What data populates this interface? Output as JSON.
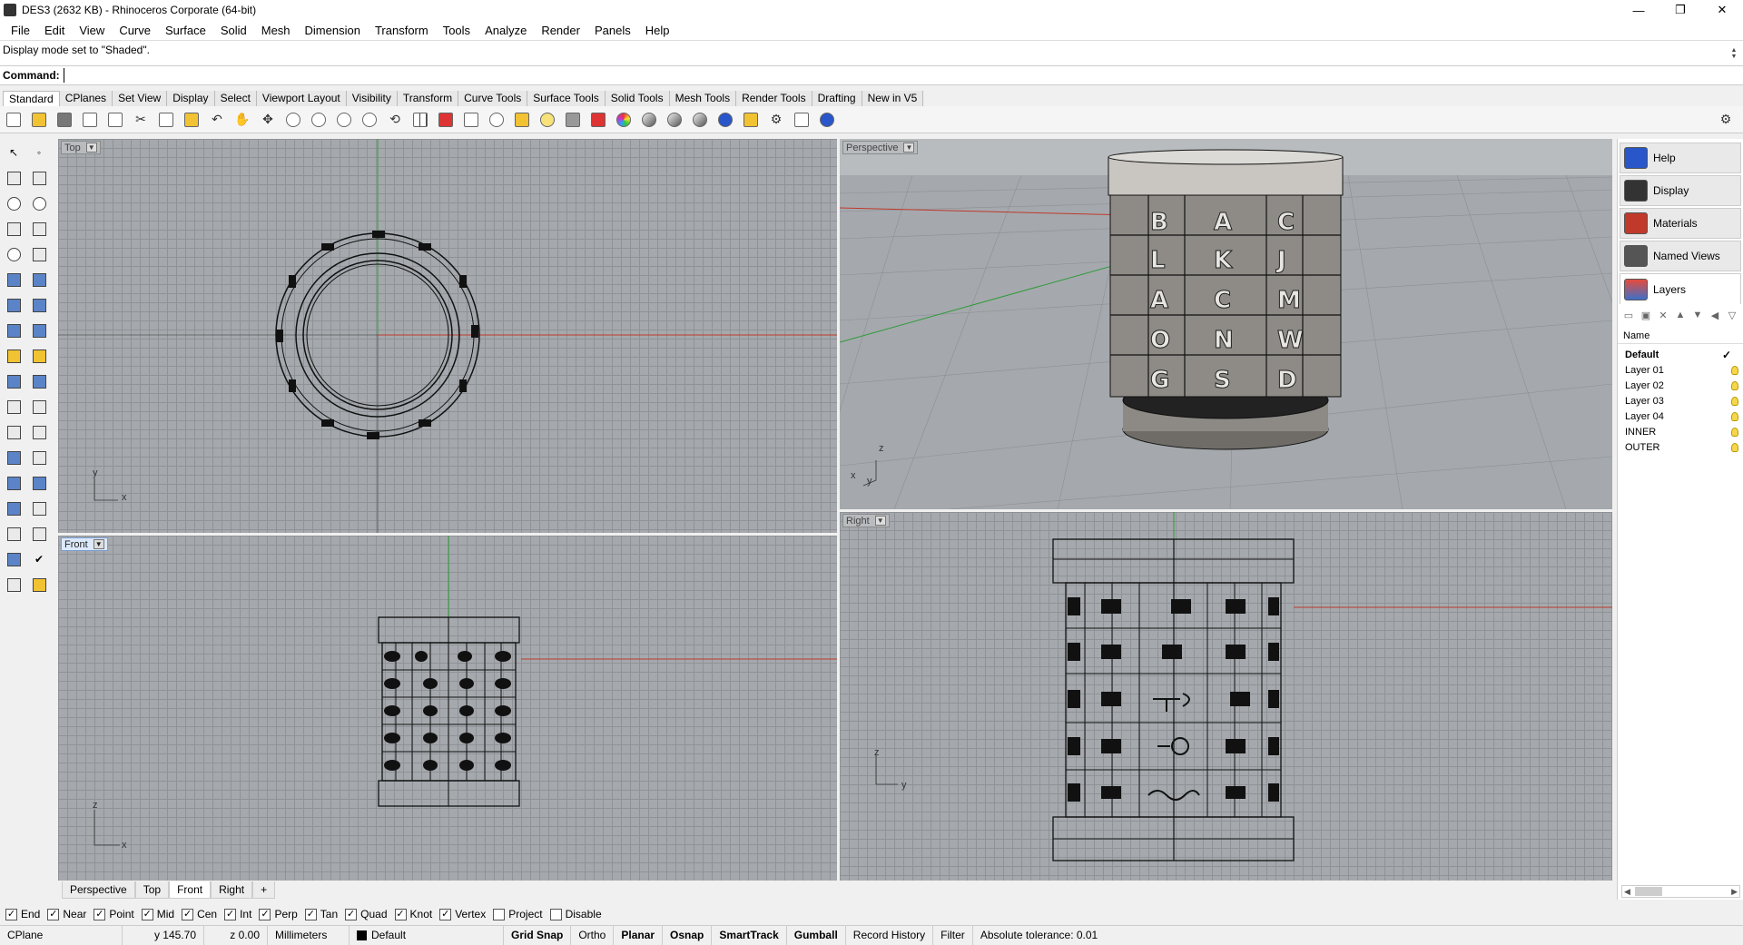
{
  "window": {
    "title": "DES3 (2632 KB) - Rhinoceros Corporate (64-bit)",
    "minimize": "—",
    "restore": "❐",
    "close": "✕"
  },
  "menu": [
    "File",
    "Edit",
    "View",
    "Curve",
    "Surface",
    "Solid",
    "Mesh",
    "Dimension",
    "Transform",
    "Tools",
    "Analyze",
    "Render",
    "Panels",
    "Help"
  ],
  "command": {
    "history": "Display mode set to \"Shaded\".",
    "label": "Command:",
    "value": ""
  },
  "toolbar_tabs": [
    "Standard",
    "CPlanes",
    "Set View",
    "Display",
    "Select",
    "Viewport Layout",
    "Visibility",
    "Transform",
    "Curve Tools",
    "Surface Tools",
    "Solid Tools",
    "Mesh Tools",
    "Render Tools",
    "Drafting",
    "New in V5"
  ],
  "viewports": {
    "top": {
      "label": "Top"
    },
    "perspective": {
      "label": "Perspective"
    },
    "front": {
      "label": "Front"
    },
    "right": {
      "label": "Right"
    }
  },
  "viewport_tabs": [
    "Perspective",
    "Top",
    "Front",
    "Right",
    "+"
  ],
  "osnaps": [
    {
      "label": "End",
      "checked": true
    },
    {
      "label": "Near",
      "checked": true
    },
    {
      "label": "Point",
      "checked": true
    },
    {
      "label": "Mid",
      "checked": true
    },
    {
      "label": "Cen",
      "checked": true
    },
    {
      "label": "Int",
      "checked": true
    },
    {
      "label": "Perp",
      "checked": true
    },
    {
      "label": "Tan",
      "checked": true
    },
    {
      "label": "Quad",
      "checked": true
    },
    {
      "label": "Knot",
      "checked": true
    },
    {
      "label": "Vertex",
      "checked": true
    },
    {
      "label": "Project",
      "checked": false
    },
    {
      "label": "Disable",
      "checked": false
    }
  ],
  "status": {
    "cplane": "CPlane",
    "y": "y 145.70",
    "z": "z 0.00",
    "units": "Millimeters",
    "layer": "Default",
    "grid_snap": "Grid Snap",
    "ortho": "Ortho",
    "planar": "Planar",
    "osnap": "Osnap",
    "smarttrack": "SmartTrack",
    "gumball": "Gumball",
    "record_history": "Record History",
    "filter": "Filter",
    "tolerance": "Absolute tolerance: 0.01"
  },
  "panel": {
    "tabs": [
      "Help",
      "Display",
      "Materials",
      "Named Views",
      "Layers"
    ],
    "layers_header": "Name",
    "layers": [
      {
        "name": "Default",
        "current": true
      },
      {
        "name": "Layer 01"
      },
      {
        "name": "Layer 02"
      },
      {
        "name": "Layer 03"
      },
      {
        "name": "Layer 04"
      },
      {
        "name": "INNER"
      },
      {
        "name": "OUTER"
      }
    ]
  },
  "axes": {
    "x": "x",
    "y": "y",
    "z": "z"
  },
  "colors": {
    "viewport_bg": "#a5a9ad",
    "x_axis": "#c0392b",
    "y_axis": "#2e9a3a",
    "active_label": "#dce9fa"
  }
}
